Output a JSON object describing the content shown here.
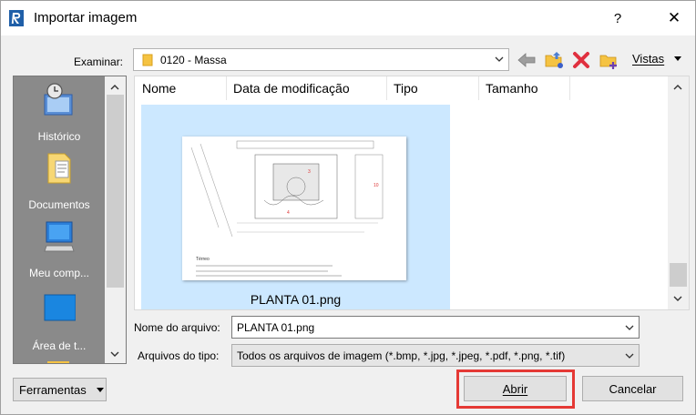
{
  "window": {
    "title": "Importar imagem",
    "help_label": "?",
    "close_label": "✕"
  },
  "lookin": {
    "label": "Examinar:",
    "value": "0120 - Massa"
  },
  "toolbar": {
    "views_label": "Vistas"
  },
  "places": [
    {
      "label": "Histórico",
      "icon": "history-icon"
    },
    {
      "label": "Documentos",
      "icon": "documents-icon"
    },
    {
      "label": "Meu comp...",
      "icon": "my-computer-icon"
    },
    {
      "label": "Área de t...",
      "icon": "desktop-icon"
    }
  ],
  "filelist": {
    "columns": [
      "Nome",
      "Data de modificação",
      "Tipo",
      "Tamanho"
    ],
    "items": [
      {
        "name": "PLANTA 01.png",
        "selected": true
      }
    ]
  },
  "filename": {
    "label": "Nome do arquivo:",
    "value": "PLANTA 01.png"
  },
  "filetype": {
    "label": "Arquivos do tipo:",
    "value": "Todos os arquivos de imagem  (*.bmp, *.jpg, *.jpeg, *.pdf, *.png, *.tif)"
  },
  "buttons": {
    "tools": "Ferramentas",
    "open": "Abrir",
    "cancel": "Cancelar"
  },
  "colors": {
    "selection": "#cce8ff",
    "highlight_ring": "#e53935",
    "places_bg": "#8a8a8a"
  }
}
